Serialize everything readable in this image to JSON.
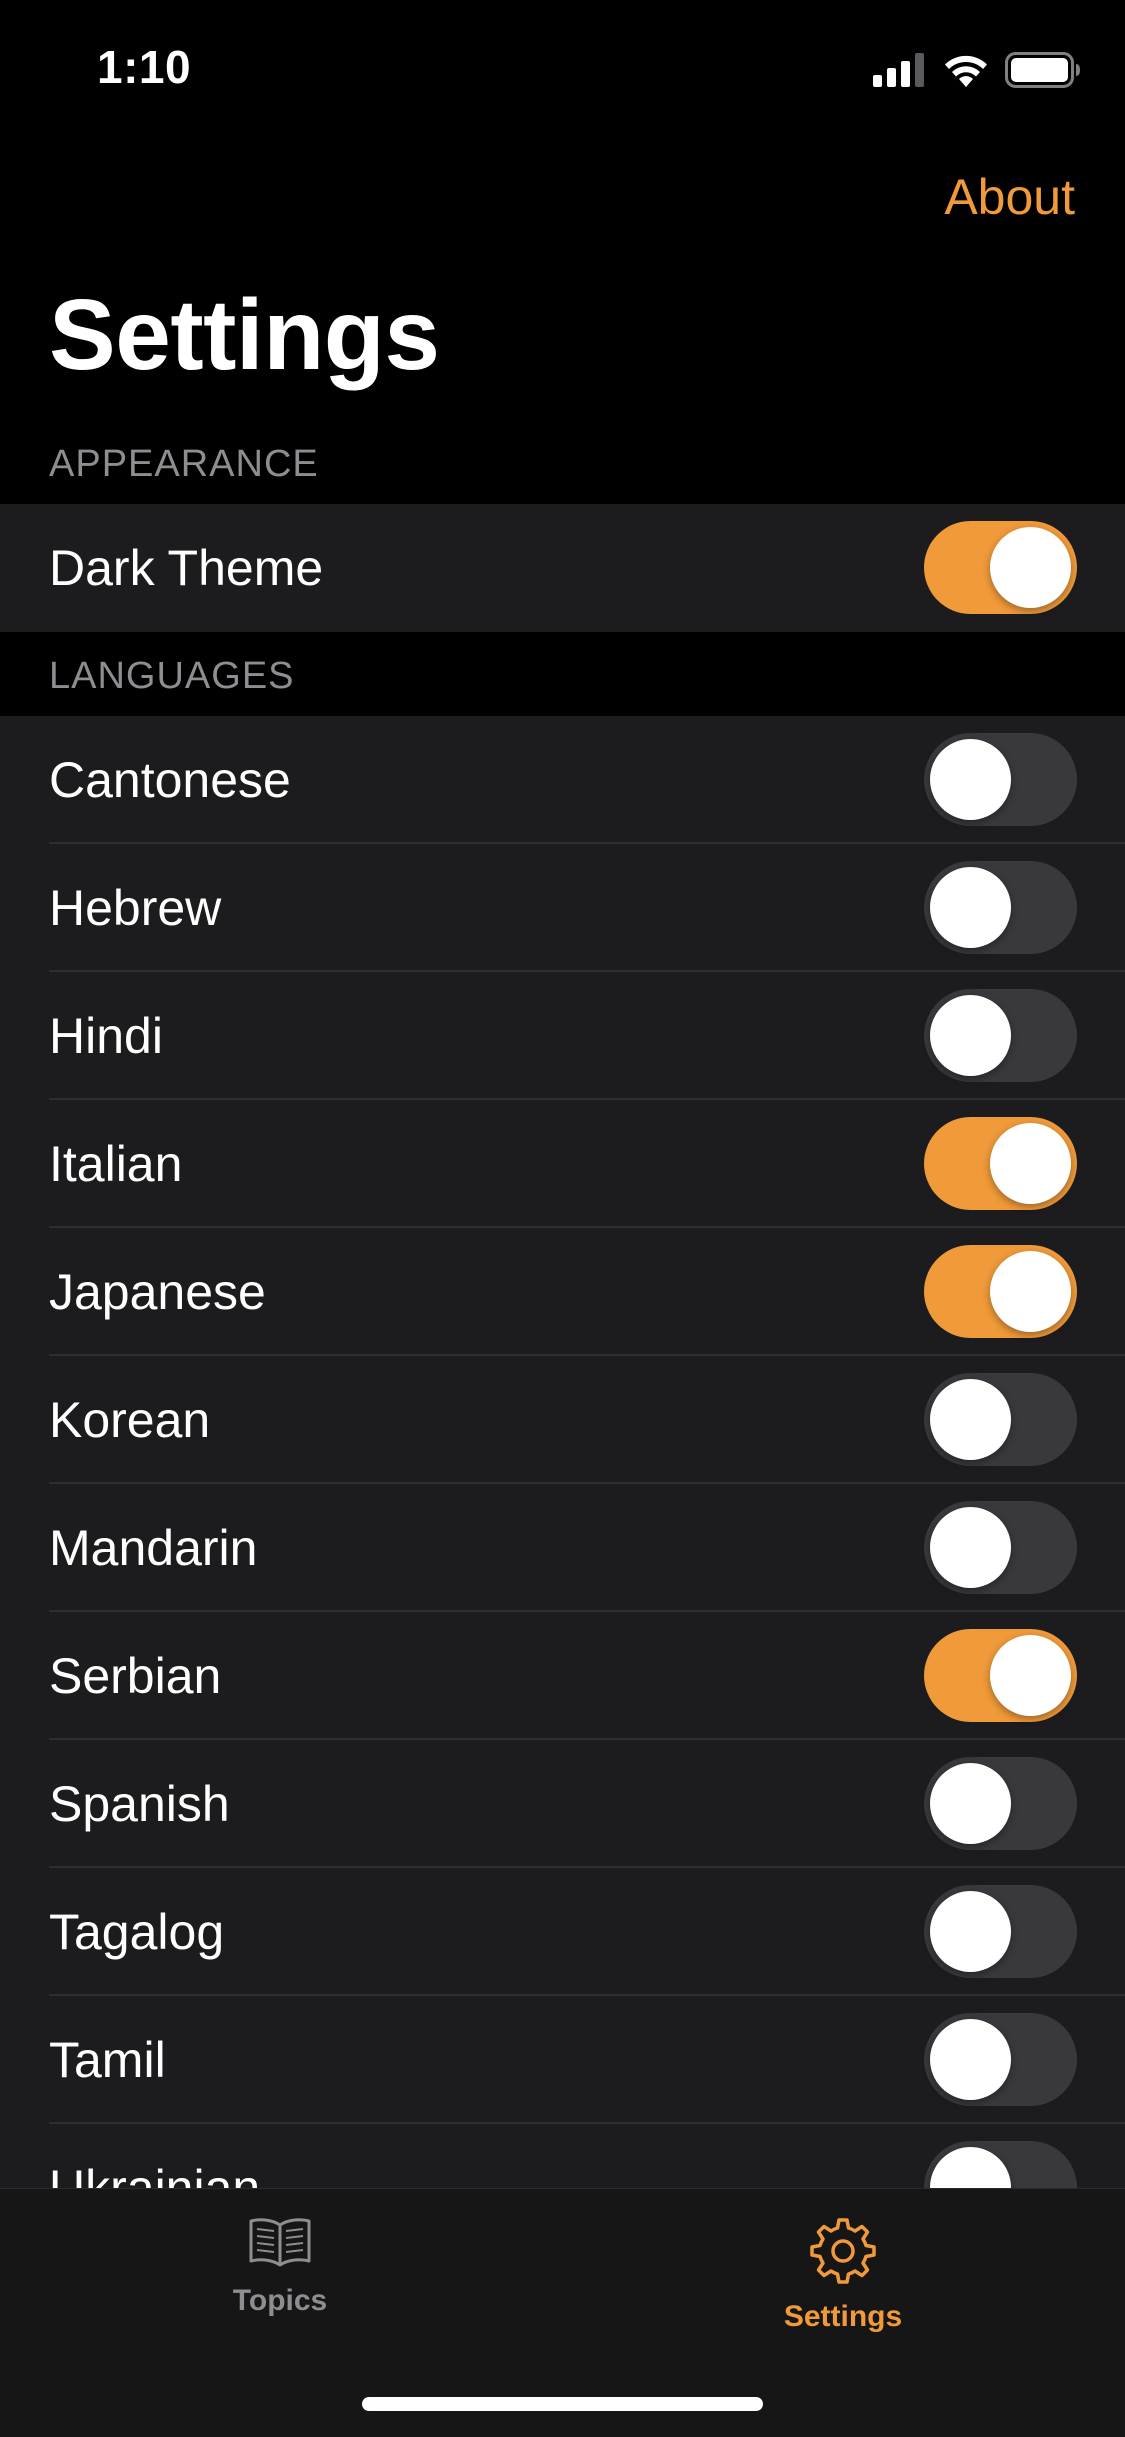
{
  "status_bar": {
    "time": "1:10"
  },
  "nav": {
    "about_label": "About"
  },
  "page_title": "Settings",
  "sections": {
    "appearance": {
      "header": "APPEARANCE",
      "items": [
        {
          "label": "Dark Theme",
          "on": true
        }
      ]
    },
    "languages": {
      "header": "LANGUAGES",
      "items": [
        {
          "label": "Cantonese",
          "on": false
        },
        {
          "label": "Hebrew",
          "on": false
        },
        {
          "label": "Hindi",
          "on": false
        },
        {
          "label": "Italian",
          "on": true
        },
        {
          "label": "Japanese",
          "on": true
        },
        {
          "label": "Korean",
          "on": false
        },
        {
          "label": "Mandarin",
          "on": false
        },
        {
          "label": "Serbian",
          "on": true
        },
        {
          "label": "Spanish",
          "on": false
        },
        {
          "label": "Tagalog",
          "on": false
        },
        {
          "label": "Tamil",
          "on": false
        },
        {
          "label": "Ukrainian",
          "on": false
        }
      ]
    }
  },
  "tab_bar": {
    "tabs": [
      {
        "label": "Topics",
        "icon": "book-icon",
        "selected": false
      },
      {
        "label": "Settings",
        "icon": "gear-icon",
        "selected": true
      }
    ]
  },
  "colors": {
    "accent": "#f09a3a",
    "background": "#000000",
    "cell": "#1c1c1e",
    "toggle_off": "#39393d",
    "secondary_text": "#8d8d92"
  }
}
